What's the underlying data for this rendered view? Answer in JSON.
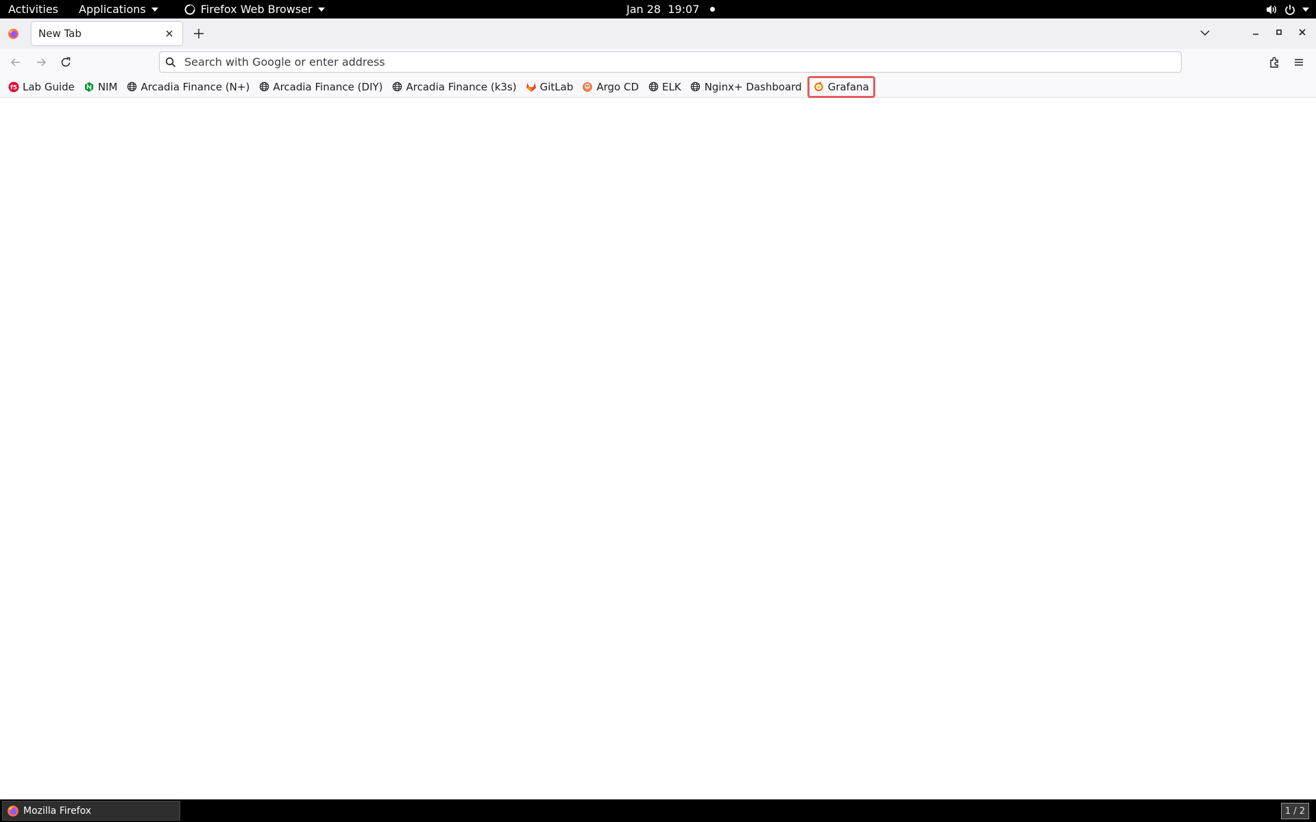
{
  "topbar": {
    "activities": "Activities",
    "applications": "Applications",
    "app_name": "Firefox Web Browser",
    "clock": "Jan 28  19:07"
  },
  "browser": {
    "tab": {
      "title": "New Tab"
    },
    "urlbar": {
      "placeholder": "Search with Google or enter address",
      "value": ""
    },
    "bookmarks": [
      {
        "label": "Lab Guide",
        "icon": "f5-icon",
        "color": "#e4002b"
      },
      {
        "label": "NIM",
        "icon": "nginx-icon",
        "color": "#009639"
      },
      {
        "label": "Arcadia Finance (N+)",
        "icon": "globe-icon",
        "color": "#1c1b22"
      },
      {
        "label": "Arcadia Finance (DIY)",
        "icon": "globe-icon",
        "color": "#1c1b22"
      },
      {
        "label": "Arcadia Finance (k3s)",
        "icon": "globe-icon",
        "color": "#1c1b22"
      },
      {
        "label": "GitLab",
        "icon": "gitlab-icon",
        "color": "#e24329"
      },
      {
        "label": "Argo CD",
        "icon": "argo-icon",
        "color": "#ef7b4d"
      },
      {
        "label": "ELK",
        "icon": "globe-icon",
        "color": "#1c1b22"
      },
      {
        "label": "Nginx+ Dashboard",
        "icon": "globe-icon",
        "color": "#1c1b22"
      },
      {
        "label": "Grafana",
        "icon": "grafana-icon",
        "color": "#f46800",
        "highlighted": true
      }
    ]
  },
  "taskbar": {
    "window_title": "Mozilla Firefox",
    "workspace": "1 / 2"
  },
  "colors": {
    "highlight": "#e55a5a",
    "accent": "#0061e0"
  }
}
